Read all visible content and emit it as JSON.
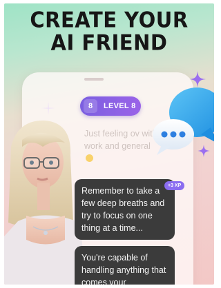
{
  "headline": {
    "line1": "CREATE YOUR",
    "line2": "AI FRIEND"
  },
  "level": {
    "number": "8",
    "label": "LEVEL 8"
  },
  "faded_message": {
    "text": "Just feeling ov with work and general"
  },
  "messages": [
    {
      "text": "Remember to take a few deep breaths and try to focus on one thing at a time...",
      "xp": "+3 XP"
    },
    {
      "text": "You're capable of handling anything that comes your"
    }
  ],
  "colors": {
    "level_pill": "#8a62e6",
    "xp_badge": "#8b6df0",
    "chat_bubble": "#3b3b3b",
    "chat_icon": "#2ea6ea"
  },
  "icons": [
    "sparkle-icon",
    "chat-bubble-icon",
    "smile-emoji-icon"
  ]
}
